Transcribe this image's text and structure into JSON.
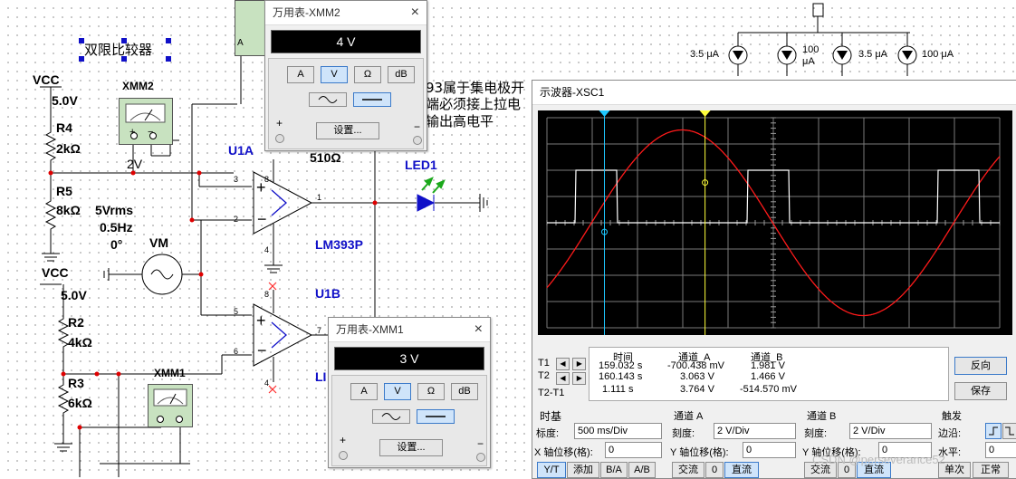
{
  "schematic": {
    "title": "双限比较器",
    "vcc_top": "VCC",
    "vcc_top_value": "5.0V",
    "vcc_bottom": "VCC",
    "vcc_bottom_value": "5.0V",
    "r4": "R4",
    "r4_val": "2kΩ",
    "r5": "R5",
    "r5_val": "8kΩ",
    "r2": "R2",
    "r2_val": "4kΩ",
    "r3": "R3",
    "r3_val": "6kΩ",
    "node_voltage": "2V",
    "source_amp": "5Vrms",
    "source_freq": "0.5Hz",
    "source_phase": "0°",
    "source_name": "VM",
    "xmm2": "XMM2",
    "xmm1": "XMM1",
    "u1a": "U1A",
    "u1b": "U1B",
    "lm393": "LM393P",
    "r_pullup_val": "510Ω",
    "led": "LED1",
    "pin3": "3",
    "pin2": "2",
    "pin1": "1",
    "pin8a": "8",
    "pin4a": "4",
    "pin5": "5",
    "pin6": "6",
    "pin7": "7",
    "pin8b": "8",
    "pin4b": "4",
    "note_lines": [
      "93属于集电极开",
      "端必须接上拉电",
      "输出高电平"
    ],
    "ua_labels": [
      "3.5 μA",
      "100 μA",
      "3.5 μA",
      "100 μA"
    ],
    "ua_label_2_line1": "100",
    "ua_label_2_line2": "μA",
    "led_partial": "LI",
    "probe_a": "A"
  },
  "mm2": {
    "title": "万用表-XMM2",
    "close": "×",
    "reading": "4 V",
    "buttons": [
      "A",
      "V",
      "Ω",
      "dB"
    ],
    "active": "V",
    "settings": "设置...",
    "plus": "+",
    "minus": "−"
  },
  "mm1": {
    "title": "万用表-XMM1",
    "close": "×",
    "reading": "3 V",
    "buttons": [
      "A",
      "V",
      "Ω",
      "dB"
    ],
    "active": "V",
    "settings": "设置...",
    "plus": "+",
    "minus": "−"
  },
  "oscilloscope": {
    "title": "示波器-XSC1",
    "readout": {
      "headers": [
        "时间",
        "通道_A",
        "通道_B"
      ],
      "rows": [
        {
          "label": "T1",
          "time": "159.032 s",
          "a": "-700.438 mV",
          "b": "1.981 V"
        },
        {
          "label": "T2",
          "time": "160.143 s",
          "a": "3.063 V",
          "b": "1.466 V"
        },
        {
          "label": "T2-T1",
          "time": "1.111 s",
          "a": "3.764 V",
          "b": "-514.570 mV"
        }
      ]
    },
    "reverse_button": "反向",
    "save_button": "保存",
    "timebase": {
      "label": "时基",
      "scale_label": "标度:",
      "scale_value": "500 ms/Div",
      "xpos_label": "X 轴位移(格):",
      "xpos_value": "0",
      "buttons": [
        "Y/T",
        "添加",
        "B/A",
        "A/B"
      ]
    },
    "channel_a": {
      "label": "通道 A",
      "scale_label": "刻度:",
      "scale_value": "2 V/Div",
      "ypos_label": "Y 轴位移(格):",
      "ypos_value": "0",
      "buttons": [
        "交流",
        "0",
        "直流"
      ]
    },
    "channel_b": {
      "label": "通道 B",
      "scale_label": "刻度:",
      "scale_value": "2 V/Div",
      "ypos_label": "Y 轴位移(格):",
      "ypos_value": "0",
      "buttons": [
        "交流",
        "0",
        "直流"
      ]
    },
    "trigger": {
      "label": "触发",
      "edge_label": "边沿:",
      "level_label": "水平:",
      "level_value": "0",
      "buttons": [
        "单次",
        "正常"
      ]
    },
    "cursor_colors": {
      "t1": "#1ec8ff",
      "t2": "#ffff3a"
    },
    "trace_colors": {
      "a": "#ff1a1a",
      "b": "#ffffff"
    }
  },
  "watermark": "CSDN @perseverance52"
}
